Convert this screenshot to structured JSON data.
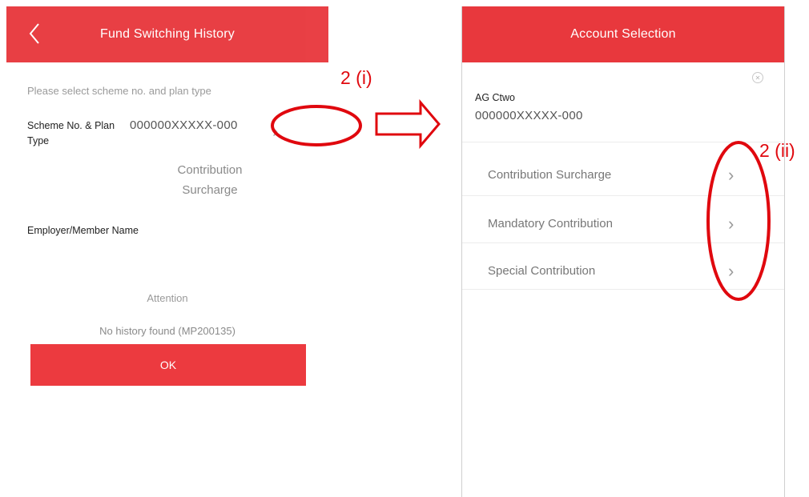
{
  "left_screen": {
    "title": "Fund Switching History",
    "hint": "Please select scheme no. and plan type",
    "scheme_label": "Scheme No. & Plan Type",
    "scheme_value": "000000XXXXX-000",
    "plan_type": "Contribution Surcharge",
    "employer_label": "Employer/Member Name",
    "attention": "Attention",
    "no_history": "No history found (MP200135)",
    "ok_label": "OK"
  },
  "right_screen": {
    "title": "Account Selection",
    "account_name": "AG Ctwo",
    "account_number": "000000XXXXX-000",
    "plans": [
      {
        "label": "Contribution Surcharge"
      },
      {
        "label": "Mandatory Contribution"
      },
      {
        "label": "Special Contribution"
      }
    ]
  },
  "annotations": {
    "step_i": "2 (i)",
    "step_ii": "2 (ii)"
  },
  "colors": {
    "brand_red": "#e8383d",
    "annotation_red": "#e0080e"
  },
  "icons": {
    "back": "chevron-left-icon",
    "row": "chevron-right-icon",
    "close": "close-circle-icon"
  }
}
